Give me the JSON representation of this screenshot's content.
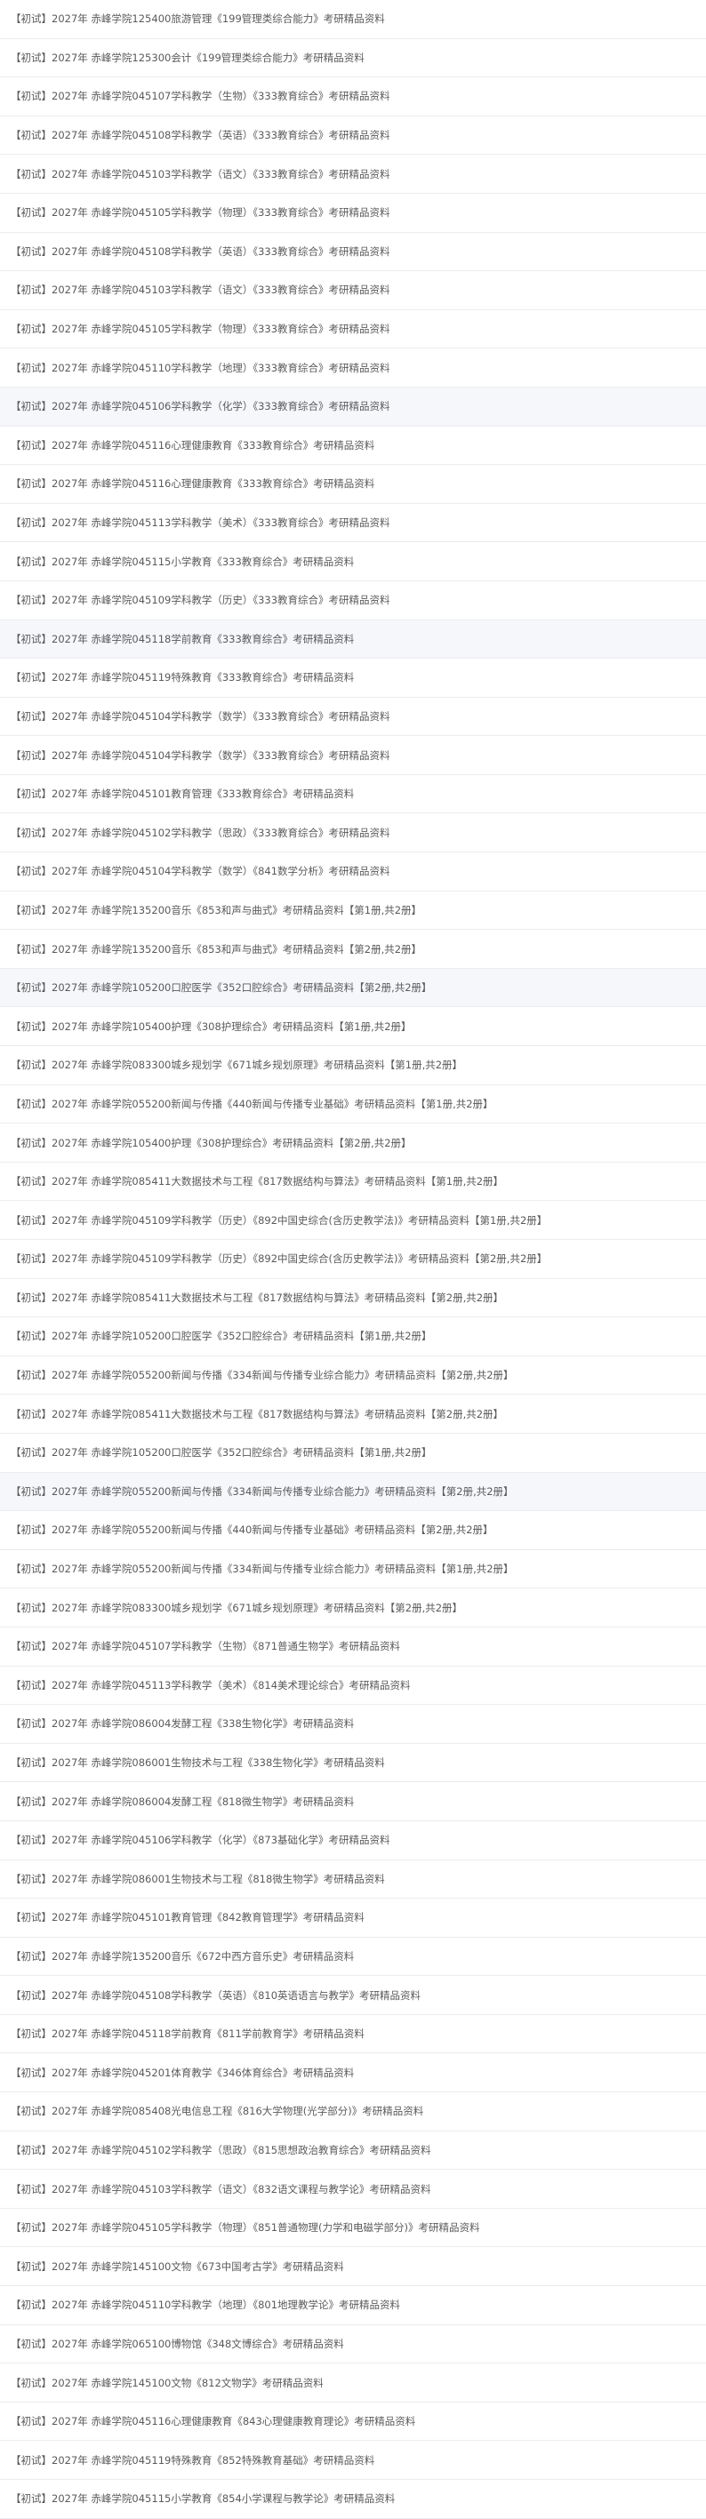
{
  "items": [
    {
      "title": "【初试】2027年 赤峰学院125400旅游管理《199管理类综合能力》考研精品资料"
    },
    {
      "title": "【初试】2027年 赤峰学院125300会计《199管理类综合能力》考研精品资料"
    },
    {
      "title": "【初试】2027年 赤峰学院045107学科教学（生物）《333教育综合》考研精品资料"
    },
    {
      "title": "【初试】2027年 赤峰学院045108学科教学（英语）《333教育综合》考研精品资料"
    },
    {
      "title": "【初试】2027年 赤峰学院045103学科教学（语文）《333教育综合》考研精品资料"
    },
    {
      "title": "【初试】2027年 赤峰学院045105学科教学（物理）《333教育综合》考研精品资料"
    },
    {
      "title": "【初试】2027年 赤峰学院045108学科教学（英语）《333教育综合》考研精品资料"
    },
    {
      "title": "【初试】2027年 赤峰学院045103学科教学（语文）《333教育综合》考研精品资料"
    },
    {
      "title": "【初试】2027年 赤峰学院045105学科教学（物理）《333教育综合》考研精品资料"
    },
    {
      "title": "【初试】2027年 赤峰学院045110学科教学（地理）《333教育综合》考研精品资料"
    },
    {
      "title": "【初试】2027年 赤峰学院045106学科教学（化学）《333教育综合》考研精品资料",
      "hl": true
    },
    {
      "title": "【初试】2027年 赤峰学院045116心理健康教育《333教育综合》考研精品资料"
    },
    {
      "title": "【初试】2027年 赤峰学院045116心理健康教育《333教育综合》考研精品资料"
    },
    {
      "title": "【初试】2027年 赤峰学院045113学科教学（美术）《333教育综合》考研精品资料"
    },
    {
      "title": "【初试】2027年 赤峰学院045115小学教育《333教育综合》考研精品资料"
    },
    {
      "title": "【初试】2027年 赤峰学院045109学科教学（历史）《333教育综合》考研精品资料"
    },
    {
      "title": "【初试】2027年 赤峰学院045118学前教育《333教育综合》考研精品资料",
      "hl": true
    },
    {
      "title": "【初试】2027年 赤峰学院045119特殊教育《333教育综合》考研精品资料"
    },
    {
      "title": "【初试】2027年 赤峰学院045104学科教学（数学）《333教育综合》考研精品资料"
    },
    {
      "title": "【初试】2027年 赤峰学院045104学科教学（数学）《333教育综合》考研精品资料"
    },
    {
      "title": "【初试】2027年 赤峰学院045101教育管理《333教育综合》考研精品资料"
    },
    {
      "title": "【初试】2027年 赤峰学院045102学科教学（思政）《333教育综合》考研精品资料"
    },
    {
      "title": "【初试】2027年 赤峰学院045104学科教学（数学）《841数学分析》考研精品资料"
    },
    {
      "title": "【初试】2027年 赤峰学院135200音乐《853和声与曲式》考研精品资料【第1册,共2册】"
    },
    {
      "title": "【初试】2027年 赤峰学院135200音乐《853和声与曲式》考研精品资料【第2册,共2册】"
    },
    {
      "title": "【初试】2027年 赤峰学院105200口腔医学《352口腔综合》考研精品资料【第2册,共2册】",
      "hl": true
    },
    {
      "title": "【初试】2027年 赤峰学院105400护理《308护理综合》考研精品资料【第1册,共2册】"
    },
    {
      "title": "【初试】2027年 赤峰学院083300城乡规划学《671城乡规划原理》考研精品资料【第1册,共2册】"
    },
    {
      "title": "【初试】2027年 赤峰学院055200新闻与传播《440新闻与传播专业基础》考研精品资料【第1册,共2册】"
    },
    {
      "title": "【初试】2027年 赤峰学院105400护理《308护理综合》考研精品资料【第2册,共2册】"
    },
    {
      "title": "【初试】2027年 赤峰学院085411大数据技术与工程《817数据结构与算法》考研精品资料【第1册,共2册】"
    },
    {
      "title": "【初试】2027年 赤峰学院045109学科教学（历史）《892中国史综合(含历史教学法)》考研精品资料【第1册,共2册】"
    },
    {
      "title": "【初试】2027年 赤峰学院045109学科教学（历史）《892中国史综合(含历史教学法)》考研精品资料【第2册,共2册】"
    },
    {
      "title": "【初试】2027年 赤峰学院085411大数据技术与工程《817数据结构与算法》考研精品资料【第2册,共2册】"
    },
    {
      "title": "【初试】2027年 赤峰学院105200口腔医学《352口腔综合》考研精品资料【第1册,共2册】"
    },
    {
      "title": "【初试】2027年 赤峰学院055200新闻与传播《334新闻与传播专业综合能力》考研精品资料【第2册,共2册】"
    },
    {
      "title": "【初试】2027年 赤峰学院085411大数据技术与工程《817数据结构与算法》考研精品资料【第2册,共2册】"
    },
    {
      "title": "【初试】2027年 赤峰学院105200口腔医学《352口腔综合》考研精品资料【第1册,共2册】"
    },
    {
      "title": "【初试】2027年 赤峰学院055200新闻与传播《334新闻与传播专业综合能力》考研精品资料【第2册,共2册】",
      "hl": true
    },
    {
      "title": "【初试】2027年 赤峰学院055200新闻与传播《440新闻与传播专业基础》考研精品资料【第2册,共2册】"
    },
    {
      "title": "【初试】2027年 赤峰学院055200新闻与传播《334新闻与传播专业综合能力》考研精品资料【第1册,共2册】"
    },
    {
      "title": "【初试】2027年 赤峰学院083300城乡规划学《671城乡规划原理》考研精品资料【第2册,共2册】"
    },
    {
      "title": "【初试】2027年 赤峰学院045107学科教学（生物）《871普通生物学》考研精品资料"
    },
    {
      "title": "【初试】2027年 赤峰学院045113学科教学（美术）《814美术理论综合》考研精品资料"
    },
    {
      "title": "【初试】2027年 赤峰学院086004发酵工程《338生物化学》考研精品资料"
    },
    {
      "title": "【初试】2027年 赤峰学院086001生物技术与工程《338生物化学》考研精品资料"
    },
    {
      "title": "【初试】2027年 赤峰学院086004发酵工程《818微生物学》考研精品资料"
    },
    {
      "title": "【初试】2027年 赤峰学院045106学科教学（化学）《873基础化学》考研精品资料"
    },
    {
      "title": "【初试】2027年 赤峰学院086001生物技术与工程《818微生物学》考研精品资料"
    },
    {
      "title": "【初试】2027年 赤峰学院045101教育管理《842教育管理学》考研精品资料"
    },
    {
      "title": "【初试】2027年 赤峰学院135200音乐《672中西方音乐史》考研精品资料"
    },
    {
      "title": "【初试】2027年 赤峰学院045108学科教学（英语）《810英语语言与教学》考研精品资料"
    },
    {
      "title": "【初试】2027年 赤峰学院045118学前教育《811学前教育学》考研精品资料"
    },
    {
      "title": "【初试】2027年 赤峰学院045201体育教学《346体育综合》考研精品资料"
    },
    {
      "title": "【初试】2027年 赤峰学院085408光电信息工程《816大学物理(光学部分)》考研精品资料"
    },
    {
      "title": "【初试】2027年 赤峰学院045102学科教学（思政）《815思想政治教育综合》考研精品资料"
    },
    {
      "title": "【初试】2027年 赤峰学院045103学科教学（语文）《832语文课程与教学论》考研精品资料"
    },
    {
      "title": "【初试】2027年 赤峰学院045105学科教学（物理）《851普通物理(力学和电磁学部分)》考研精品资料"
    },
    {
      "title": "【初试】2027年 赤峰学院145100文物《673中国考古学》考研精品资料"
    },
    {
      "title": "【初试】2027年 赤峰学院045110学科教学（地理）《801地理教学论》考研精品资料"
    },
    {
      "title": "【初试】2027年 赤峰学院065100博物馆《348文博综合》考研精品资料"
    },
    {
      "title": "【初试】2027年 赤峰学院145100文物《812文物学》考研精品资料"
    },
    {
      "title": "【初试】2027年 赤峰学院045116心理健康教育《843心理健康教育理论》考研精品资料"
    },
    {
      "title": "【初试】2027年 赤峰学院045119特殊教育《852特殊教育基础》考研精品资料"
    },
    {
      "title": "【初试】2027年 赤峰学院045115小学教育《854小学课程与教学论》考研精品资料"
    }
  ]
}
